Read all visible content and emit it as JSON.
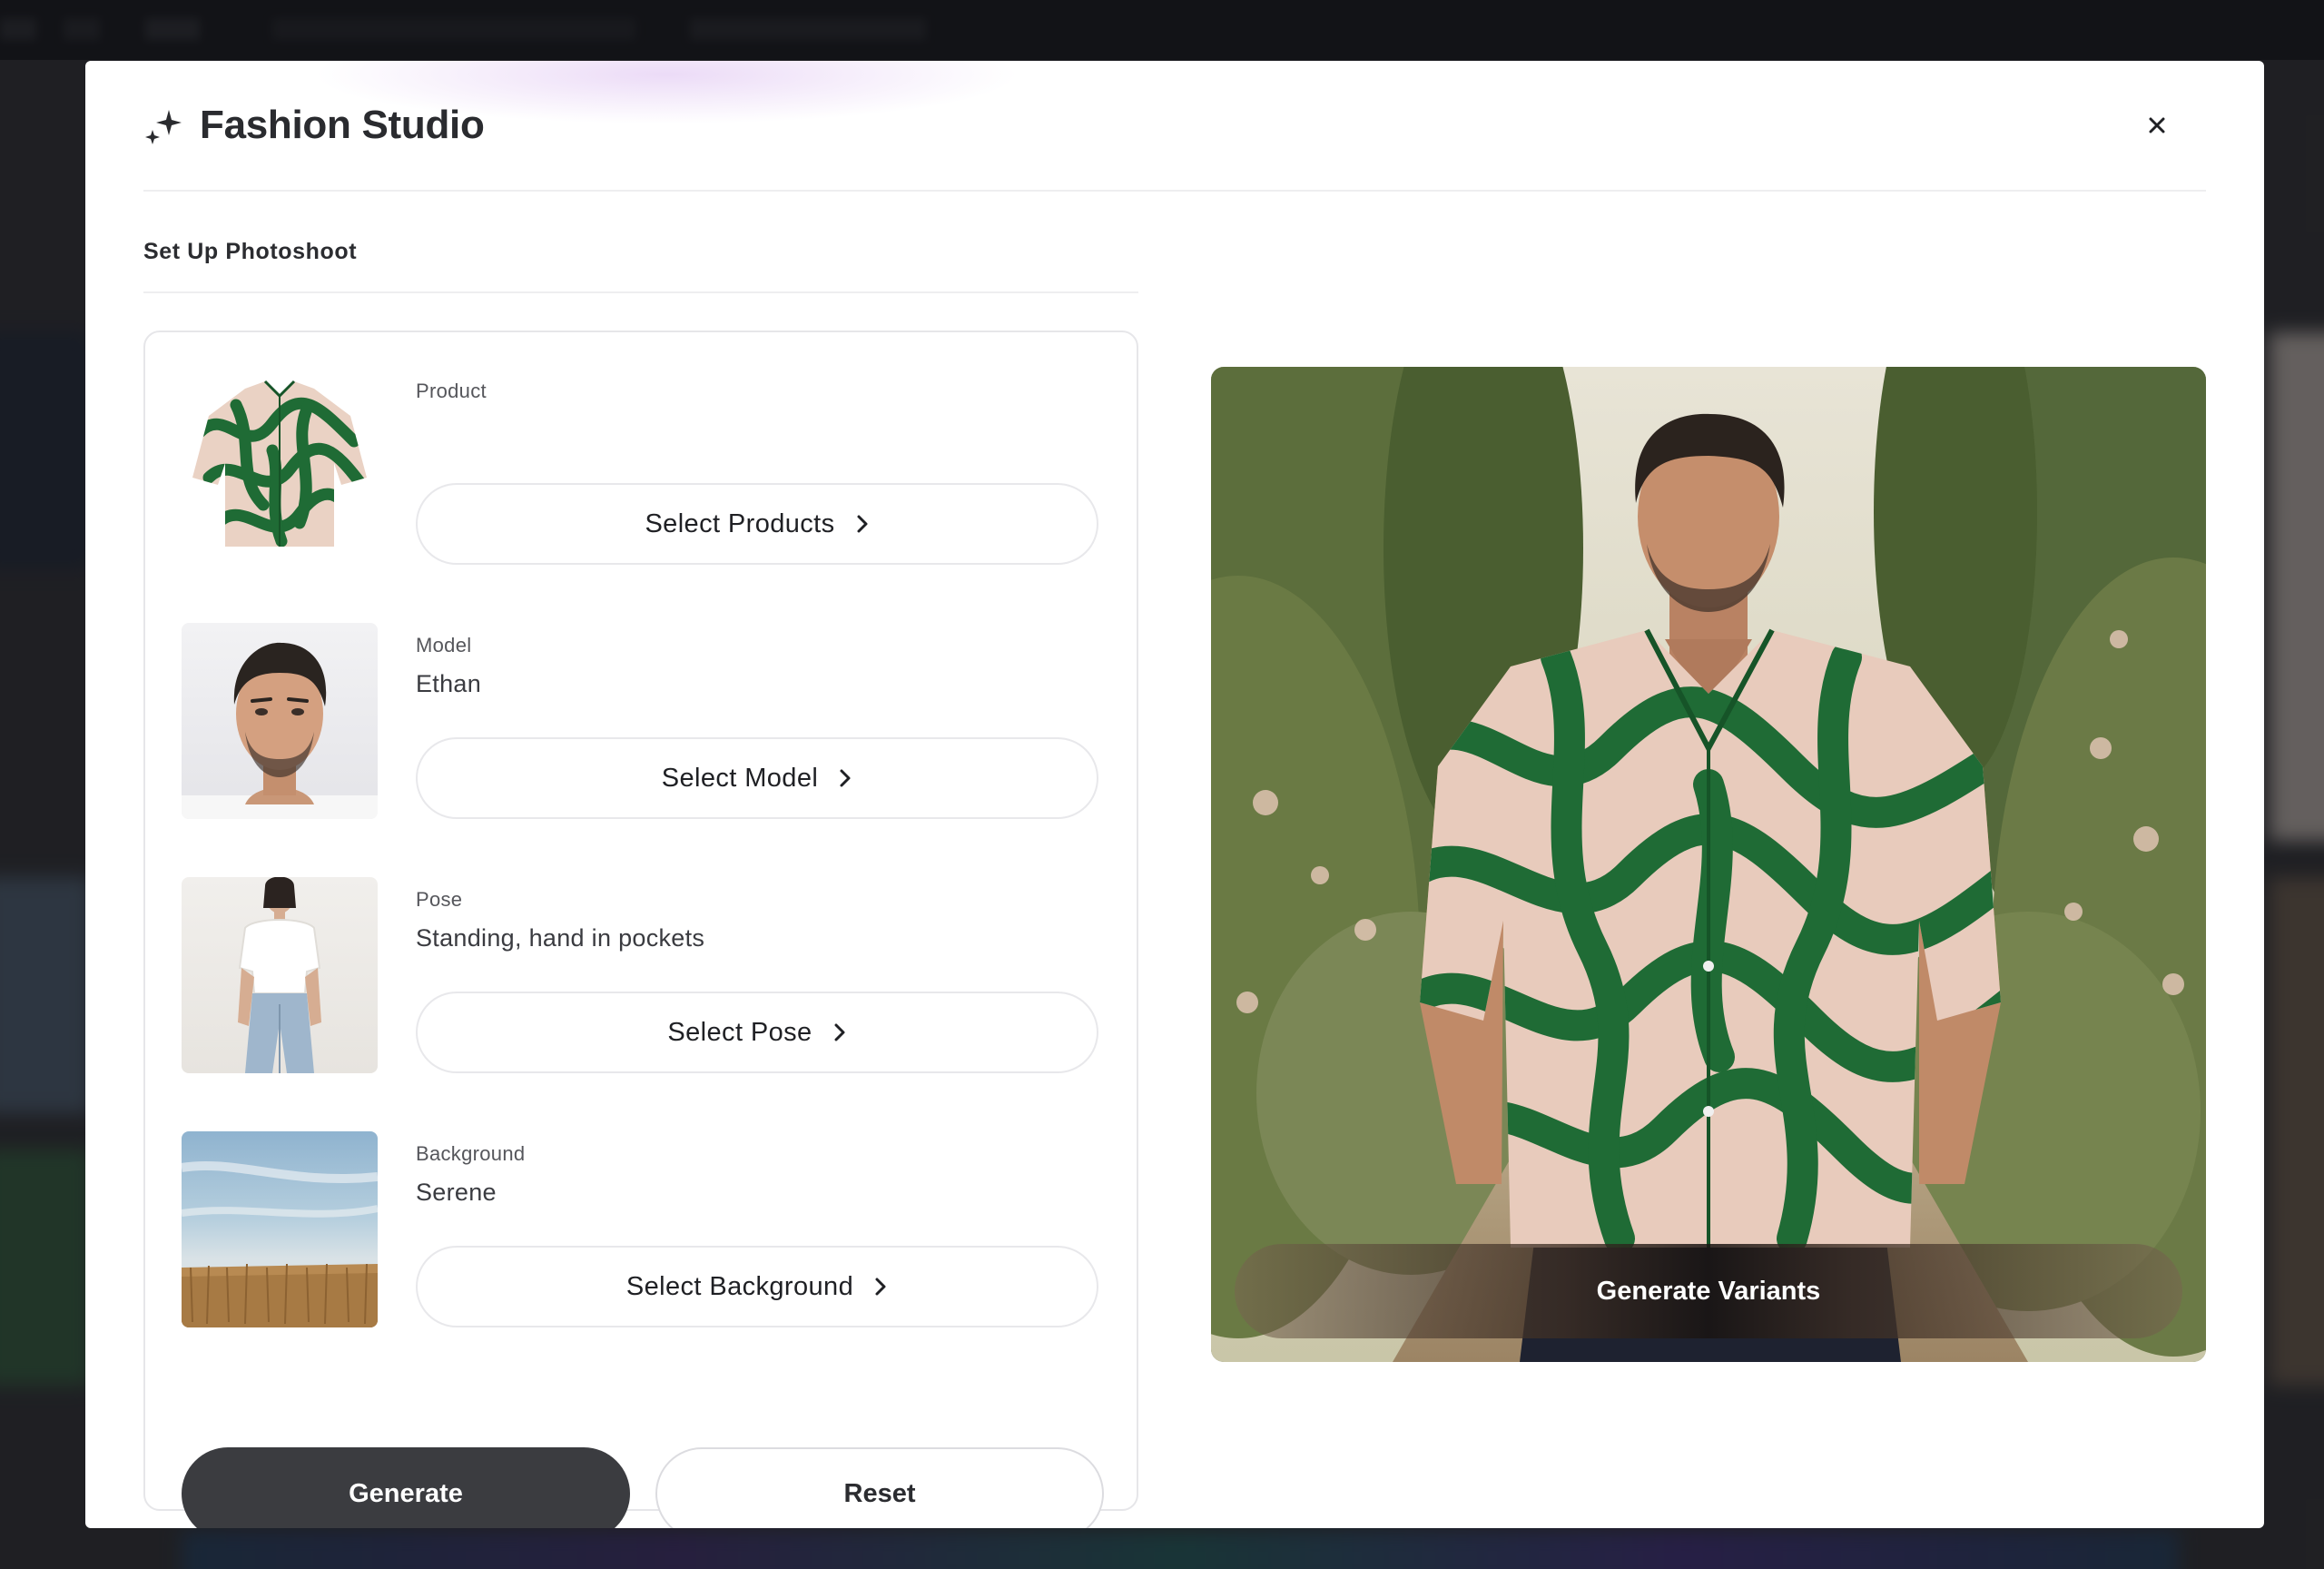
{
  "modal": {
    "title": "Fashion Studio",
    "close_label": "×",
    "section_title": "Set Up Photoshoot"
  },
  "setup": {
    "rows": [
      {
        "label": "Product",
        "value": "",
        "button": "Select Products",
        "thumb": "green-tropical-shirt"
      },
      {
        "label": "Model",
        "value": "Ethan",
        "button": "Select Model",
        "thumb": "model-portrait"
      },
      {
        "label": "Pose",
        "value": "Standing, hand in pockets",
        "button": "Select Pose",
        "thumb": "pose-photo"
      },
      {
        "label": "Background",
        "value": "Serene",
        "button": "Select Background",
        "thumb": "wheat-field-sky"
      }
    ],
    "generate_label": "Generate",
    "reset_label": "Reset"
  },
  "preview": {
    "generate_variants_label": "Generate Variants"
  },
  "icons": {
    "header": "sparkle-icon",
    "close": "close-icon",
    "chevron": "chevron-right-icon"
  },
  "colors": {
    "primary_button": "#3b3c40",
    "shirt_green": "#1f6b35",
    "shirt_pink": "#ead2c4"
  }
}
